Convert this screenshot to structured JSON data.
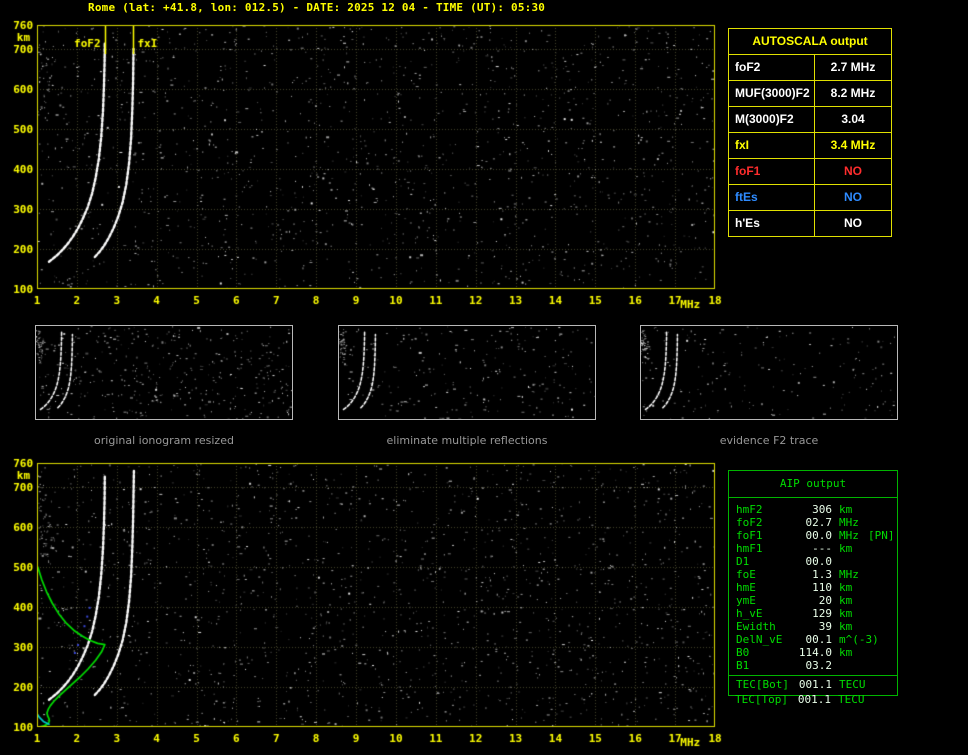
{
  "header": {
    "title": "Rome (lat: +41.8, lon: 012.5) - DATE: 2025 12 04 - TIME (UT): 05:30"
  },
  "colors": {
    "background": "#000000",
    "axis_yellow": "#ffff00",
    "plot_border": "#dcdc00",
    "grid": "rgba(180,180,110,0.38)",
    "trace_white": "#ffffff",
    "profile_green": "#00dd00",
    "profile_cyan": "#00cccc",
    "restored_blue": "#4455ff",
    "autoscala_border": "#e0e000",
    "aip_green": "#00dd00",
    "alert_red": "#ff2d2d",
    "alert_blue": "#2e8bff",
    "caption_gray": "#989898"
  },
  "autoscala": {
    "title": "AUTOSCALA output",
    "rows": [
      {
        "label": "foF2",
        "value": "2.7 MHz",
        "color": "#ffffff"
      },
      {
        "label": "MUF(3000)F2",
        "value": "8.2 MHz",
        "color": "#ffffff"
      },
      {
        "label": "M(3000)F2",
        "value": "3.04",
        "color": "#ffffff"
      },
      {
        "label": "fxI",
        "value": "3.4 MHz",
        "color": "#ffff00"
      },
      {
        "label": "foF1",
        "value": "NO",
        "color": "#ff2d2d"
      },
      {
        "label": "ftEs",
        "value": "NO",
        "color": "#2e8bff"
      },
      {
        "label": "h'Es",
        "value": "NO",
        "color": "#ffffff"
      }
    ]
  },
  "aip": {
    "title": "AIP output",
    "rows": [
      {
        "label": "hmF2",
        "value": "306",
        "unit": "km"
      },
      {
        "label": "foF2",
        "value": "02.7",
        "unit": "MHz"
      },
      {
        "label": "foF1",
        "value": "00.0",
        "unit": "MHz",
        "extra": "[PN]"
      },
      {
        "label": "hmF1",
        "value": "---",
        "unit": "km"
      },
      {
        "label": "D1",
        "value": "00.0",
        "unit": ""
      },
      {
        "label": "foE",
        "value": "1.3",
        "unit": "MHz"
      },
      {
        "label": "hmE",
        "value": "110",
        "unit": "km"
      },
      {
        "label": "ymE",
        "value": "20",
        "unit": "km"
      },
      {
        "label": "h_vE",
        "value": "129",
        "unit": "km"
      },
      {
        "label": "Ewidth",
        "value": "39",
        "unit": "km"
      },
      {
        "label": "DelN_vE",
        "value": "00.1",
        "unit": "m^(-3)"
      },
      {
        "label": "B0",
        "value": "114.0",
        "unit": "km"
      },
      {
        "label": "B1",
        "value": "03.2",
        "unit": ""
      },
      {
        "label": "TEC[Bot]",
        "value": "001.1",
        "unit": "TECU",
        "separator_above": true
      },
      {
        "label": "TEC[Top]",
        "value": "001.1",
        "unit": "TECU",
        "outside_box": true
      }
    ]
  },
  "thumbnails": [
    {
      "caption": "original ionogram resized"
    },
    {
      "caption": "eliminate multiple reflections"
    },
    {
      "caption": "evidence F2 trace"
    }
  ],
  "chart_data": [
    {
      "id": "main_ionogram",
      "type": "scatter",
      "title": "ionogram with autoscaled characteristics",
      "xlabel": "MHz",
      "ylabel": "km",
      "xlim": [
        1,
        18
      ],
      "ylim": [
        100,
        760
      ],
      "xticks": [
        1,
        2,
        3,
        4,
        5,
        6,
        7,
        8,
        9,
        10,
        11,
        12,
        13,
        14,
        15,
        16,
        17,
        18
      ],
      "yticks": [
        760,
        700,
        600,
        500,
        400,
        300,
        200,
        100
      ],
      "grid": true,
      "annotations": [
        {
          "label": "foF2",
          "x_mhz": 2.7,
          "side": "left"
        },
        {
          "label": "fxI",
          "x_mhz": 3.4,
          "side": "right"
        }
      ],
      "series": [
        {
          "name": "F2 ordinary trace",
          "color": "#ffffff",
          "dashed": true,
          "points": [
            [
              1.3,
              168
            ],
            [
              1.4,
              176
            ],
            [
              1.52,
              186
            ],
            [
              1.64,
              198
            ],
            [
              1.77,
              213
            ],
            [
              1.9,
              231
            ],
            [
              2.03,
              252
            ],
            [
              2.15,
              276
            ],
            [
              2.27,
              304
            ],
            [
              2.38,
              338
            ],
            [
              2.47,
              378
            ],
            [
              2.55,
              425
            ],
            [
              2.61,
              480
            ],
            [
              2.655,
              545
            ],
            [
              2.68,
              610
            ],
            [
              2.695,
              670
            ],
            [
              2.7,
              715
            ]
          ]
        },
        {
          "name": "F2 extraordinary trace",
          "color": "#ffffff",
          "dashed": true,
          "points": [
            [
              2.45,
              180
            ],
            [
              2.56,
              192
            ],
            [
              2.68,
              208
            ],
            [
              2.8,
              228
            ],
            [
              2.92,
              252
            ],
            [
              3.04,
              282
            ],
            [
              3.15,
              318
            ],
            [
              3.24,
              362
            ],
            [
              3.31,
              415
            ],
            [
              3.36,
              478
            ],
            [
              3.39,
              548
            ],
            [
              3.41,
              620
            ],
            [
              3.42,
              700
            ]
          ]
        },
        {
          "name": "spread echoes",
          "color": "#e8e8e8",
          "style": "speckle",
          "points": [
            [
              1.05,
              650
            ],
            [
              1.1,
              620
            ],
            [
              1.16,
              660
            ],
            [
              1.22,
              600
            ],
            [
              1.28,
              640
            ],
            [
              1.07,
              690
            ],
            [
              1.33,
              615
            ],
            [
              1.2,
              575
            ],
            [
              1.14,
              550
            ],
            [
              1.25,
              530
            ],
            [
              1.1,
              700
            ],
            [
              1.18,
              670
            ]
          ]
        }
      ]
    },
    {
      "id": "profile_ionogram",
      "type": "scatter",
      "title": "ionogram with restored trace and electron density profile",
      "xlabel": "MHz",
      "ylabel": "km",
      "xlim": [
        1,
        18
      ],
      "ylim": [
        100,
        760
      ],
      "xticks": [
        1,
        2,
        3,
        4,
        5,
        6,
        7,
        8,
        9,
        10,
        11,
        12,
        13,
        14,
        15,
        16,
        17,
        18
      ],
      "yticks": [
        760,
        700,
        600,
        500,
        400,
        300,
        200,
        100
      ],
      "grid": true,
      "series": [
        {
          "name": "F2 ordinary trace",
          "color": "#ffffff",
          "dashed": true,
          "points": [
            [
              1.3,
              168
            ],
            [
              1.4,
              176
            ],
            [
              1.52,
              186
            ],
            [
              1.64,
              198
            ],
            [
              1.77,
              213
            ],
            [
              1.9,
              231
            ],
            [
              2.03,
              252
            ],
            [
              2.15,
              276
            ],
            [
              2.27,
              304
            ],
            [
              2.38,
              338
            ],
            [
              2.47,
              378
            ],
            [
              2.55,
              425
            ],
            [
              2.61,
              480
            ],
            [
              2.655,
              545
            ],
            [
              2.68,
              610
            ],
            [
              2.695,
              670
            ],
            [
              2.7,
              730
            ]
          ]
        },
        {
          "name": "F2 extraordinary trace",
          "color": "#ffffff",
          "dashed": true,
          "points": [
            [
              2.45,
              180
            ],
            [
              2.56,
              192
            ],
            [
              2.68,
              208
            ],
            [
              2.8,
              228
            ],
            [
              2.92,
              252
            ],
            [
              3.04,
              282
            ],
            [
              3.15,
              318
            ],
            [
              3.24,
              362
            ],
            [
              3.31,
              415
            ],
            [
              3.36,
              478
            ],
            [
              3.39,
              548
            ],
            [
              3.41,
              620
            ],
            [
              3.43,
              740
            ]
          ]
        },
        {
          "name": "spread echoes",
          "color": "#e8e8e8",
          "style": "speckle",
          "points": [
            [
              1.05,
              660
            ],
            [
              1.12,
              630
            ],
            [
              1.2,
              600
            ],
            [
              1.08,
              700
            ],
            [
              1.15,
              670
            ],
            [
              1.25,
              640
            ],
            [
              1.3,
              610
            ],
            [
              1.1,
              580
            ],
            [
              1.2,
              560
            ],
            [
              1.35,
              580
            ],
            [
              1.05,
              720
            ],
            [
              1.4,
              550
            ],
            [
              1.18,
              540
            ],
            [
              1.28,
              520
            ]
          ]
        },
        {
          "name": "restored trace points",
          "color": "#4455ff",
          "style": "dots",
          "points": [
            [
              1.95,
              285
            ],
            [
              2.03,
              305
            ],
            [
              2.11,
              328
            ],
            [
              2.19,
              352
            ],
            [
              2.26,
              376
            ],
            [
              2.32,
              398
            ]
          ]
        },
        {
          "name": "electron density profile (hmF2 306 km, foF2 2.7 MHz)",
          "color": "#00dd00",
          "width": 1.7,
          "points": [
            [
              1.02,
              500
            ],
            [
              1.12,
              468
            ],
            [
              1.24,
              438
            ],
            [
              1.38,
              410
            ],
            [
              1.54,
              384
            ],
            [
              1.72,
              361
            ],
            [
              1.92,
              342
            ],
            [
              2.12,
              328
            ],
            [
              2.32,
              317
            ],
            [
              2.52,
              309
            ],
            [
              2.7,
              306
            ],
            [
              2.62,
              288
            ],
            [
              2.47,
              267
            ],
            [
              2.28,
              245
            ],
            [
              2.08,
              225
            ],
            [
              1.88,
              207
            ],
            [
              1.7,
              191
            ],
            [
              1.55,
              177
            ],
            [
              1.43,
              165
            ],
            [
              1.34,
              154
            ],
            [
              1.28,
              144
            ],
            [
              1.25,
              135
            ],
            [
              1.27,
              127
            ],
            [
              1.3,
              121
            ],
            [
              1.31,
              115
            ],
            [
              1.29,
              110
            ],
            [
              1.24,
              106
            ],
            [
              1.15,
              102
            ],
            [
              1.05,
              100
            ]
          ]
        },
        {
          "name": "profile E-region segment",
          "color": "#00cccc",
          "width": 1.7,
          "points": [
            [
              0.99,
              135
            ],
            [
              1.06,
              124
            ],
            [
              1.16,
              114
            ],
            [
              1.3,
              107
            ]
          ]
        }
      ]
    }
  ]
}
